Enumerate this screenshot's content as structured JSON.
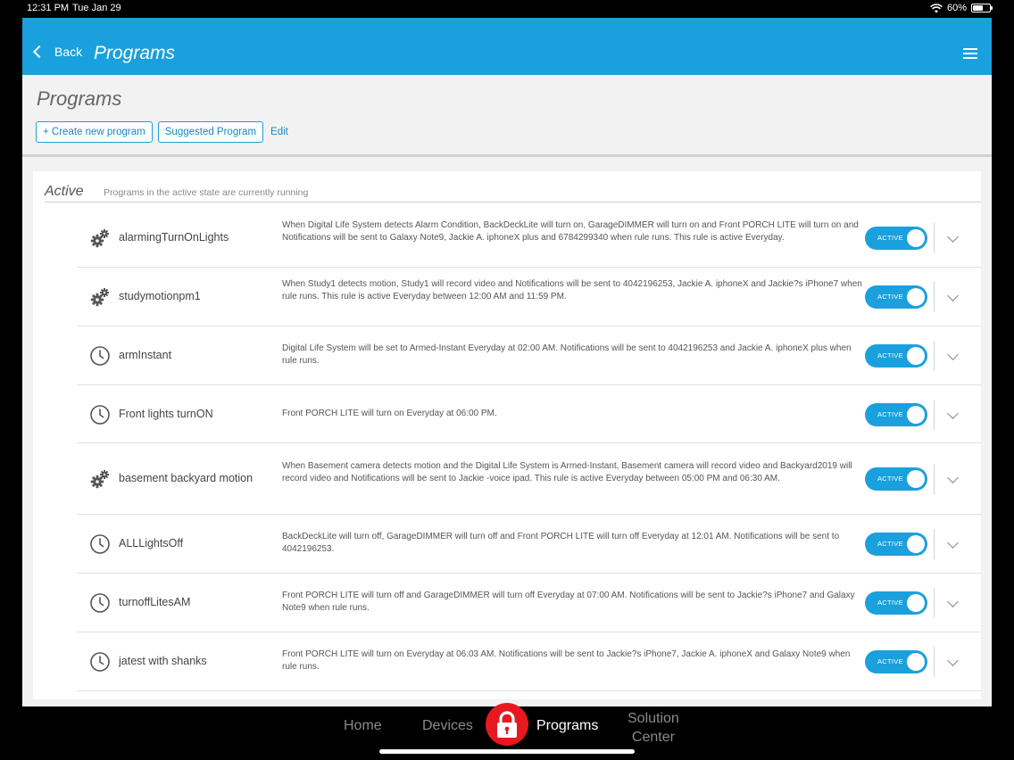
{
  "status_bar": {
    "time": "12:31 PM",
    "date": "Tue Jan 29",
    "battery": "60%",
    "battery_level": 0.6
  },
  "header": {
    "back_label": "Back",
    "title": "Programs",
    "menu_icon": "hamburger-icon"
  },
  "subheader": {
    "title": "Programs",
    "create_label": "+ Create new program",
    "suggested_label": "Suggested Program",
    "edit_label": "Edit"
  },
  "section": {
    "title": "Active",
    "description": "Programs in the active state are currently running"
  },
  "programs": [
    {
      "icon": "gears-icon",
      "name": "alarmingTurnOnLights",
      "description": "When Digital Life System detects Alarm Condition, BackDeckLite will turn on, GarageDIMMER will turn on and Front PORCH LITE will turn on and Notifications will be sent to Galaxy Note9, Jackie A. iphoneX plus and 6784299340 when rule runs. This rule is active Everyday.",
      "status": "ACTIVE"
    },
    {
      "icon": "gears-icon",
      "name": "studymotionpm1",
      "description": "When Study1 detects motion, Study1 will record video and Notifications will be sent to 4042196253, Jackie A. iphoneX and Jackie?s iPhone7 when rule runs. This rule is active Everyday between 12:00 AM and 11:59 PM.",
      "status": "ACTIVE"
    },
    {
      "icon": "clock-icon",
      "name": "armInstant",
      "description": "Digital Life System will be set to Armed-Instant Everyday at 02:00 AM. Notifications will be sent to 4042196253 and Jackie A. iphoneX plus when rule runs.",
      "status": "ACTIVE"
    },
    {
      "icon": "clock-icon",
      "name": "Front lights turnON",
      "description": "Front PORCH LITE will turn on Everyday at 06:00 PM.",
      "status": "ACTIVE"
    },
    {
      "icon": "gears-icon",
      "name": "basement backyard motion",
      "description": "When Basement camera detects motion and the Digital Life System is Armed-Instant, Basement camera will record video and Backyard2019 will record video and Notifications will be sent to Jackie -voice ipad. This rule is active Everyday between 05:00 PM and 06:30 AM.",
      "status": "ACTIVE"
    },
    {
      "icon": "clock-icon",
      "name": "ALLLightsOff",
      "description": "BackDeckLite will turn off, GarageDIMMER will turn off and Front PORCH LITE will turn off Everyday at 12:01 AM. Notifications will be sent to 4042196253.",
      "status": "ACTIVE"
    },
    {
      "icon": "clock-icon",
      "name": "turnoffLitesAM",
      "description": "Front PORCH LITE will turn off and GarageDIMMER will turn off Everyday at 07:00 AM. Notifications will be sent to Jackie?s iPhone7 and Galaxy Note9 when rule runs.",
      "status": "ACTIVE"
    },
    {
      "icon": "clock-icon",
      "name": "jatest with shanks",
      "description": "Front PORCH LITE will turn on Everyday at 06:03 AM. Notifications will be sent to Jackie?s iPhone7, Jackie A. iphoneX and Galaxy Note9 when rule runs.",
      "status": "ACTIVE"
    }
  ],
  "tabbar": {
    "home": "Home",
    "devices": "Devices",
    "lock_icon": "lock-icon",
    "programs": "Programs",
    "solution_line1": "Solution",
    "solution_line2": "Center"
  },
  "colors": {
    "brand_blue": "#1aa0dc",
    "lock_red": "#e5191f"
  }
}
